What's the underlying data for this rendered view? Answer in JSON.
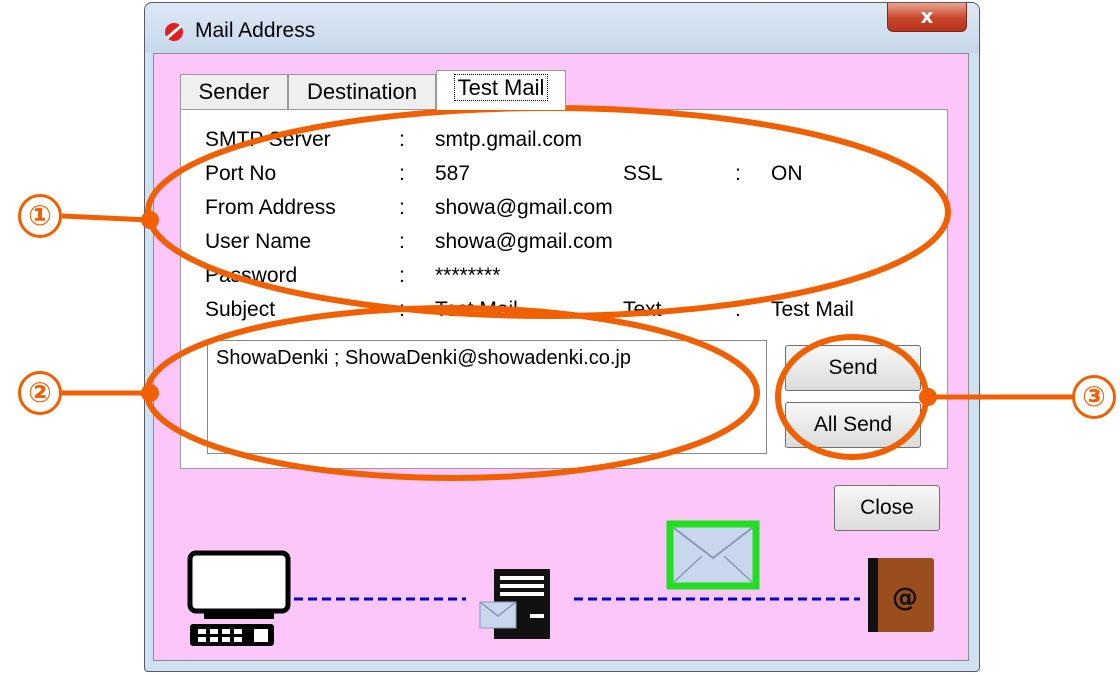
{
  "window": {
    "title": "Mail Address",
    "close_glyph": "x"
  },
  "tabs": [
    {
      "label": "Sender",
      "active": false
    },
    {
      "label": "Destination",
      "active": false
    },
    {
      "label": "Test Mail",
      "active": true
    }
  ],
  "fields": {
    "smtp_label": "SMTP Server",
    "smtp_value": "smtp.gmail.com",
    "port_label": "Port No",
    "port_value": "587",
    "ssl_label": "SSL",
    "ssl_value": "ON",
    "from_label": "From Address",
    "from_value": "showa@gmail.com",
    "user_label": "User Name",
    "user_value": "showa@gmail.com",
    "password_label": "Password",
    "password_value": "********",
    "subject_label": "Subject",
    "subject_value": "Test Mail",
    "text_label": "Text",
    "text_value": "Test Mail",
    "separator": ":"
  },
  "destinations": [
    "ShowaDenki ; ShowaDenki@showadenki.co.jp"
  ],
  "buttons": {
    "send": "Send",
    "all_send": "All Send",
    "close": "Close"
  },
  "diagram": {
    "address_book_glyph": "@",
    "line_color": "#0000cc",
    "highlight_color": "#22dd22"
  },
  "annotations": {
    "marker_1": "①",
    "marker_2": "②",
    "marker_3": "③",
    "color": "#f06000"
  }
}
